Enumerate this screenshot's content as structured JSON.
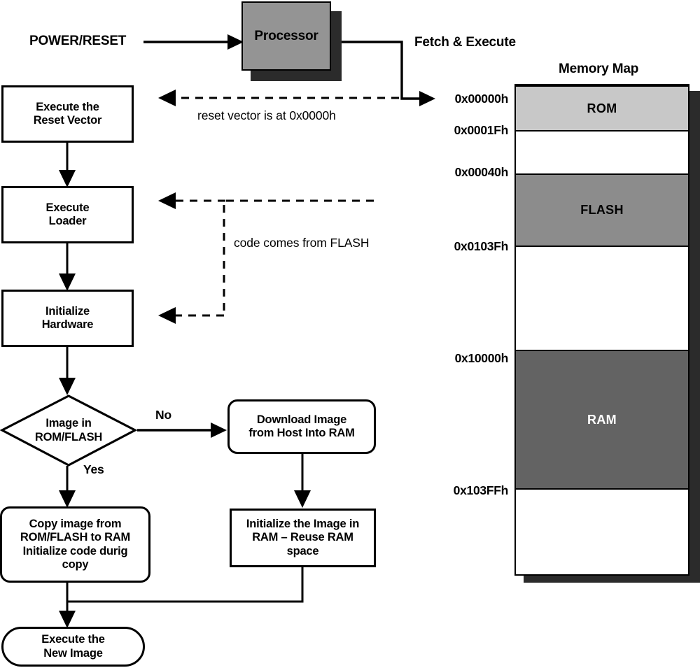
{
  "diagram": {
    "title_memory_map": "Memory Map",
    "labels": {
      "power_reset": "POWER/RESET",
      "fetch_execute": "Fetch & Execute",
      "reset_vector_note": "reset vector is at 0x0000h",
      "code_from_flash_note": "code comes from FLASH",
      "branch_no": "No",
      "branch_yes": "Yes"
    },
    "processor": {
      "label": "Processor",
      "fill": "#949494",
      "shadow": "#2b2b2b"
    },
    "nodes": {
      "execute_reset_vector": "Execute the\nReset Vector",
      "execute_loader": "Execute\nLoader",
      "initialize_hardware": "Initialize\nHardware",
      "decision_image_in": "Image in\nROM/FLASH",
      "download_image": "Download Image\nfrom Host Into RAM",
      "copy_image": "Copy image from\nROM/FLASH to RAM\nInitialize code durig\ncopy",
      "initialize_image_ram": "Initialize the Image in\nRAM – Reuse RAM\nspace",
      "execute_new_image": "Execute the\nNew Image"
    },
    "memory_map": {
      "addresses": [
        {
          "text": "0x00000h"
        },
        {
          "text": "0x0001Fh"
        },
        {
          "text": "0x00040h"
        },
        {
          "text": "0x0103Fh"
        },
        {
          "text": "0x10000h"
        },
        {
          "text": "0x103FFh"
        }
      ],
      "segments": [
        {
          "name": "ROM",
          "label": "ROM",
          "fill": "#c8c8c8",
          "text_color": "#000000"
        },
        {
          "name": "FLASH",
          "label": "FLASH",
          "fill": "#8c8c8c",
          "text_color": "#000000"
        },
        {
          "name": "RAM",
          "label": "RAM",
          "fill": "#636363",
          "text_color": "#ffffff"
        }
      ],
      "shadow": "#2b2b2b"
    }
  }
}
